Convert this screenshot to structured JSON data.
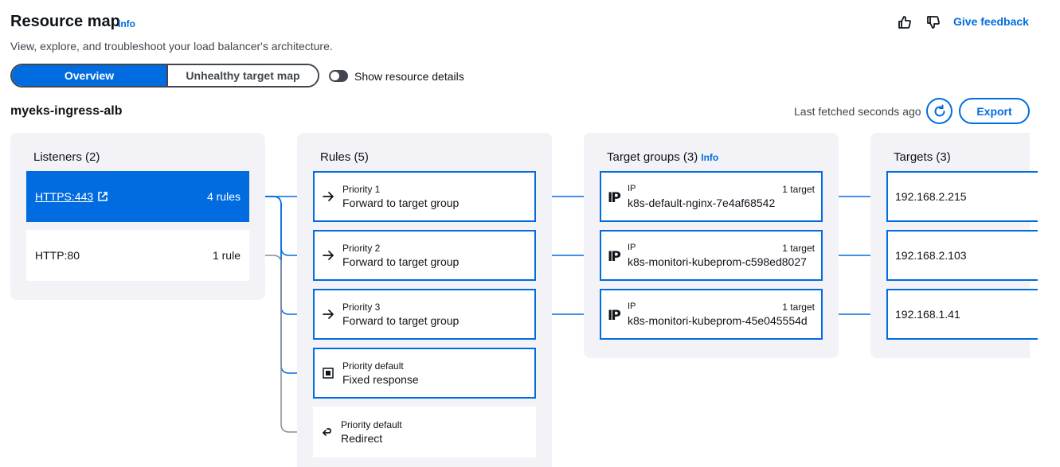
{
  "header": {
    "title": "Resource map",
    "info": "Info",
    "subtitle": "View, explore, and troubleshoot your load balancer's architecture.",
    "feedback": "Give feedback"
  },
  "view_toggle": {
    "overview": "Overview",
    "unhealthy": "Unhealthy target map",
    "selected": "Overview"
  },
  "resource_details_toggle": {
    "label": "Show resource details",
    "on": false
  },
  "load_balancer": {
    "name": "myeks-ingress-alb",
    "last_fetched": "Last fetched seconds ago",
    "export": "Export"
  },
  "listeners": {
    "title": "Listeners (2)",
    "items": [
      {
        "name": "HTTPS:443",
        "rules": "4 rules"
      },
      {
        "name": "HTTP:80",
        "rules": "1 rule"
      }
    ]
  },
  "rules": {
    "title": "Rules (5)",
    "items": [
      {
        "priority": "Priority 1",
        "action": "Forward to target group",
        "icon": "arrow-right-icon"
      },
      {
        "priority": "Priority 2",
        "action": "Forward to target group",
        "icon": "arrow-right-icon"
      },
      {
        "priority": "Priority 3",
        "action": "Forward to target group",
        "icon": "arrow-right-icon"
      },
      {
        "priority": "Priority default",
        "action": "Fixed response",
        "icon": "fixed-response-icon"
      },
      {
        "priority": "Priority default",
        "action": "Redirect",
        "icon": "redirect-icon"
      }
    ]
  },
  "target_groups": {
    "title": "Target groups (3)",
    "info": "Info",
    "items": [
      {
        "type": "IP",
        "count": "1 target",
        "name": "k8s-default-nginx-7e4af68542"
      },
      {
        "type": "IP",
        "count": "1 target",
        "name": "k8s-monitori-kubeprom-c598ed8027"
      },
      {
        "type": "IP",
        "count": "1 target",
        "name": "k8s-monitori-kubeprom-45e045554d"
      }
    ]
  },
  "targets": {
    "title": "Targets (3)",
    "items": [
      {
        "ip": "192.168.2.215"
      },
      {
        "ip": "192.168.2.103"
      },
      {
        "ip": "192.168.1.41"
      }
    ]
  },
  "colors": {
    "accent": "#006ce0",
    "inactive_line": "#8c8c94",
    "panel": "#f3f3f7",
    "text": "#0f141a"
  }
}
